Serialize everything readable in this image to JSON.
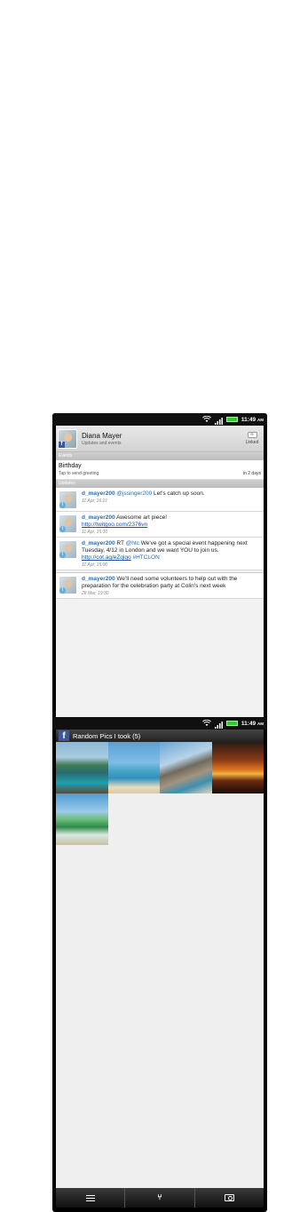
{
  "status": {
    "time": "11:49",
    "ampm": "AM"
  },
  "contact": {
    "name": "Diana Mayer",
    "subtitle": "Updates and events",
    "linked_label": "Linked"
  },
  "sections": {
    "events": "Events",
    "updates": "Updates"
  },
  "event": {
    "title": "Birthday",
    "subtitle": "Tap to send greeting",
    "when": "in 2 days"
  },
  "updates": [
    {
      "user": "d_mayer200",
      "mention": "@jssinger200",
      "text": " Let's catch up soon.",
      "time": "11 Apr, 16:21"
    },
    {
      "user": "d_mayer200",
      "text": " Awesome art piece!",
      "link": "http://twitgoo.com/2376vn",
      "time": "11 Apr, 15:10"
    },
    {
      "user": "d_mayer200",
      "prefix": " RT ",
      "mention": "@htc",
      "text": " We've got a special event happening next Tuesday, 4/12 in London and we want YOU to join us. ",
      "link": "http://cot.ag/eZqiqo",
      "tag": " #HTCLON",
      "time": "11 Apr, 15:00"
    },
    {
      "user": "d_mayer200",
      "text": " We'll need some volunteers to help out with the preparation for the celebration party at Colin's next week",
      "time": "28 Mar, 19:30"
    }
  ],
  "tabs1": [
    "contact-card-icon",
    "chat-icon",
    "mail-icon",
    "refresh-icon",
    "gallery-icon"
  ],
  "album": {
    "title": "Random Pics I took (5)",
    "fb_glyph": "f",
    "photo_count": 5
  },
  "tabs2": [
    "menu-icon",
    "share-icon",
    "camera-icon"
  ]
}
